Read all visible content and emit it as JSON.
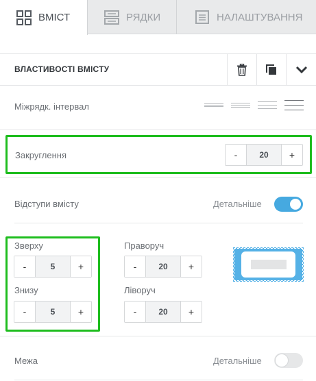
{
  "tabs": [
    {
      "label": "ВМІСТ",
      "icon": "grid-icon",
      "active": true
    },
    {
      "label": "РЯДКИ",
      "icon": "rows-icon",
      "active": false
    },
    {
      "label": "НАЛАШТУВАННЯ",
      "icon": "settings-doc-icon",
      "active": false
    }
  ],
  "panel": {
    "title": "ВЛАСТИВОСТІ ВМІСТУ",
    "actions": [
      "trash-icon",
      "copy-icon",
      "chevron-down-icon"
    ]
  },
  "line_spacing": {
    "label": "Міжрядк. інтервал",
    "options": [
      "tight",
      "normal",
      "relaxed",
      "loose"
    ],
    "selected": "loose"
  },
  "rounding": {
    "label": "Закруглення",
    "value": "20",
    "minus": "-",
    "plus": "+"
  },
  "padding": {
    "label": "Відступи вмісту",
    "detail_label": "Детальніше",
    "detail_on": true,
    "top": {
      "label": "Зверху",
      "value": "5"
    },
    "right": {
      "label": "Праворуч",
      "value": "20"
    },
    "bottom": {
      "label": "Знизу",
      "value": "5"
    },
    "left": {
      "label": "Ліворуч",
      "value": "20"
    },
    "minus": "-",
    "plus": "+"
  },
  "border": {
    "label": "Межа",
    "detail_label": "Детальніше",
    "detail_on": false
  },
  "colors": {
    "accent": "#46a9e0",
    "highlight": "#1ebd1e"
  }
}
